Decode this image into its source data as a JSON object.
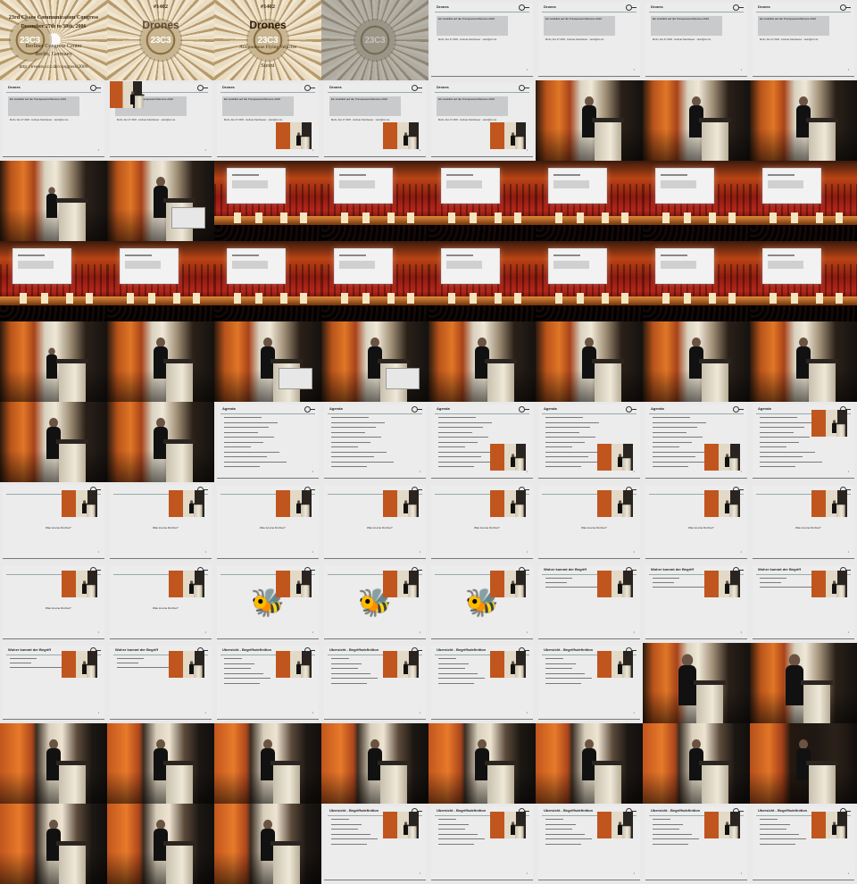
{
  "title_card": {
    "seal_text": "23C3",
    "event_number": "#1402",
    "congress": "23rd Chaos Communication Congress",
    "dates": "December 27th to 30th, 2006",
    "venue": "Berliner Congress Center",
    "city": "Berlin, Germany",
    "url": "http://events.ccc.de/congress/2006",
    "talk_title": "Drones",
    "subtitle": "Autonomous Flying Vehicles",
    "speaker": "Steini"
  },
  "slide_texts": {
    "intro_title": "Drones",
    "intro_header": "Ein Ausblick auf die Transparenzoffensive 2010",
    "intro_meta": "Berlin, Dec 27 2006 · Andreas Steinhauser · steini@ccc.de",
    "agenda_title": "Agenda",
    "question": "Was ist eine Drohne?",
    "definition_title": "Woher kommt der Begriff",
    "glossary_title": "Ubersicht - Begriffsdefinition",
    "page_number": "1"
  },
  "tiles": [
    {
      "kind": "title1"
    },
    {
      "kind": "title2"
    },
    {
      "kind": "title3"
    },
    {
      "kind": "title_fade"
    },
    {
      "kind": "slide_intro"
    },
    {
      "kind": "slide_intro"
    },
    {
      "kind": "slide_intro"
    },
    {
      "kind": "slide_intro"
    },
    {
      "kind": "slide_intro"
    },
    {
      "kind": "slide_intro",
      "inset": "top-left"
    },
    {
      "kind": "slide_intro",
      "inset": "low"
    },
    {
      "kind": "slide_intro",
      "inset": "low"
    },
    {
      "kind": "slide_intro",
      "inset": "low"
    },
    {
      "kind": "speak"
    },
    {
      "kind": "speak"
    },
    {
      "kind": "speak"
    },
    {
      "kind": "speak_far"
    },
    {
      "kind": "speak_screen"
    },
    {
      "kind": "hall"
    },
    {
      "kind": "hall"
    },
    {
      "kind": "hall"
    },
    {
      "kind": "hall"
    },
    {
      "kind": "hall"
    },
    {
      "kind": "hall"
    },
    {
      "kind": "hall"
    },
    {
      "kind": "hall"
    },
    {
      "kind": "hall"
    },
    {
      "kind": "hall"
    },
    {
      "kind": "hall"
    },
    {
      "kind": "hall"
    },
    {
      "kind": "hall"
    },
    {
      "kind": "hall"
    },
    {
      "kind": "speak_far"
    },
    {
      "kind": "speak"
    },
    {
      "kind": "speak_screen"
    },
    {
      "kind": "speak_screen"
    },
    {
      "kind": "speak"
    },
    {
      "kind": "speak"
    },
    {
      "kind": "speak"
    },
    {
      "kind": "speak"
    },
    {
      "kind": "speak"
    },
    {
      "kind": "speak"
    },
    {
      "kind": "slide_agenda"
    },
    {
      "kind": "slide_agenda"
    },
    {
      "kind": "slide_agenda",
      "inset": "low"
    },
    {
      "kind": "slide_agenda",
      "inset": "low"
    },
    {
      "kind": "slide_agenda",
      "inset": "low"
    },
    {
      "kind": "slide_agenda",
      "inset": "top"
    },
    {
      "kind": "slide_question",
      "inset": "top"
    },
    {
      "kind": "slide_question",
      "inset": "top"
    },
    {
      "kind": "slide_question",
      "inset": "top"
    },
    {
      "kind": "slide_question",
      "inset": "top"
    },
    {
      "kind": "slide_question",
      "inset": "top"
    },
    {
      "kind": "slide_question",
      "inset": "top"
    },
    {
      "kind": "slide_question",
      "inset": "top"
    },
    {
      "kind": "slide_question",
      "inset": "top"
    },
    {
      "kind": "slide_question",
      "inset": "top"
    },
    {
      "kind": "slide_question",
      "inset": "top"
    },
    {
      "kind": "slide_bee",
      "inset": "top"
    },
    {
      "kind": "slide_bee",
      "inset": "top"
    },
    {
      "kind": "slide_bee",
      "inset": "top"
    },
    {
      "kind": "slide_definition",
      "inset": "top"
    },
    {
      "kind": "slide_definition",
      "inset": "top"
    },
    {
      "kind": "slide_definition",
      "inset": "top"
    },
    {
      "kind": "slide_definition",
      "inset": "top"
    },
    {
      "kind": "slide_definition",
      "inset": "top"
    },
    {
      "kind": "slide_glossary",
      "inset": "top"
    },
    {
      "kind": "slide_glossary",
      "inset": "top"
    },
    {
      "kind": "slide_glossary",
      "inset": "top"
    },
    {
      "kind": "slide_glossary",
      "inset": "top"
    },
    {
      "kind": "speak_near"
    },
    {
      "kind": "speak_near"
    },
    {
      "kind": "speak_alt"
    },
    {
      "kind": "speak_alt"
    },
    {
      "kind": "speak_alt"
    },
    {
      "kind": "speak_alt"
    },
    {
      "kind": "speak_alt"
    },
    {
      "kind": "speak_alt"
    },
    {
      "kind": "speak_alt"
    },
    {
      "kind": "speak_dark"
    },
    {
      "kind": "speak_alt"
    },
    {
      "kind": "speak_alt"
    },
    {
      "kind": "speak_alt"
    },
    {
      "kind": "slide_glossary",
      "inset": "top"
    },
    {
      "kind": "slide_glossary",
      "inset": "top"
    },
    {
      "kind": "slide_glossary",
      "inset": "top"
    },
    {
      "kind": "slide_glossary",
      "inset": "top"
    },
    {
      "kind": "slide_glossary",
      "inset": "top"
    }
  ]
}
